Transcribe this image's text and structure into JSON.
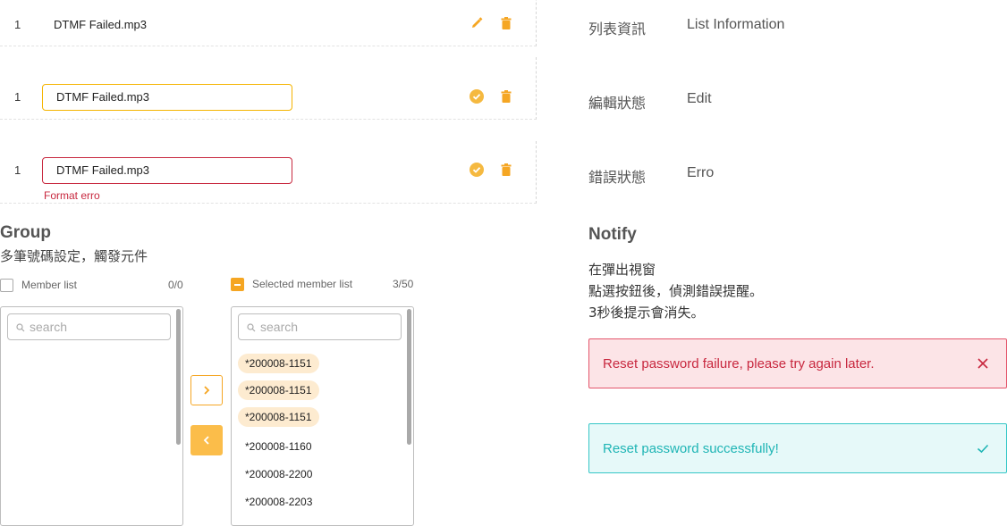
{
  "rows": [
    {
      "number": "1",
      "filename": "DTMF Failed.mp3",
      "state": "display"
    },
    {
      "number": "1",
      "filename": "DTMF Failed.mp3",
      "state": "edit"
    },
    {
      "number": "1",
      "filename": "DTMF Failed.mp3",
      "state": "error",
      "error_msg": "Format erro"
    }
  ],
  "info_labels": [
    {
      "zh": "列表資訊",
      "en": "List Information"
    },
    {
      "zh": "編輯狀態",
      "en": "Edit"
    },
    {
      "zh": "錯誤狀態",
      "en": "Erro"
    }
  ],
  "group": {
    "title": "Group",
    "subtitle": "多筆號碼設定，觸發元件",
    "member_list": {
      "label": "Member list",
      "count": "0/0",
      "search_placeholder": "search",
      "items": []
    },
    "selected_list": {
      "label": "Selected member list",
      "count": "3/50",
      "search_placeholder": "search",
      "items": [
        "*200008-1151",
        "*200008-1151",
        "*200008-1151",
        "*200008-1160",
        "*200008-2200",
        "*200008-2203"
      ],
      "highlighted_count": 3
    },
    "move_right_icon": "chevron-right-icon",
    "move_left_icon": "chevron-left-icon"
  },
  "notify": {
    "title": "Notify",
    "lines": [
      "在彈出視窗",
      "點選按鈕後，偵測錯誤提醒。",
      "3秒後提示會消失。"
    ],
    "error_alert": {
      "message": "Reset password failure, please try again later.",
      "icon": "close-icon"
    },
    "success_alert": {
      "message": "Reset password successfully!",
      "icon": "check-icon"
    }
  },
  "colors": {
    "accent": "#f5a623",
    "error": "#c8283f",
    "success": "#1fb5b5",
    "chip_highlight": "#fdebd0"
  }
}
